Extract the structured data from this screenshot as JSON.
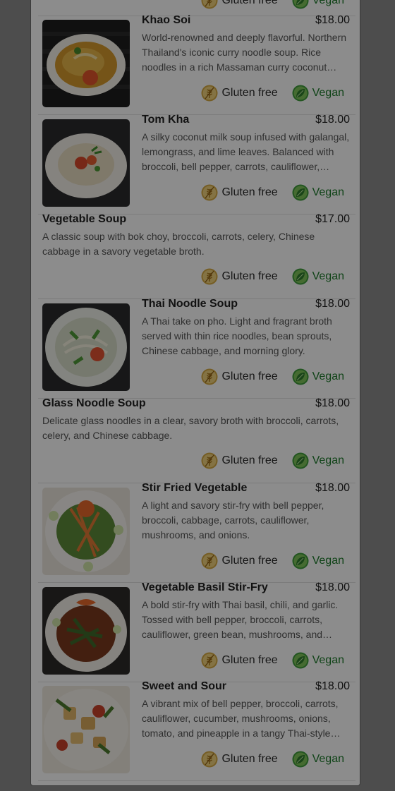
{
  "menu": {
    "tag_labels": {
      "gluten_free": "Gluten free",
      "vegan": "Vegan"
    },
    "colors": {
      "gluten_free": "#d6a943",
      "vegan": "#3f9b3b",
      "vegan_text": "#1d7a2a",
      "backdrop": "#8c8c8c"
    },
    "items": [
      {
        "name": "Khao Soi",
        "price": "$18.00",
        "description": "World-renowned and deeply flavorful. Northern Thailand's iconic curry noodle soup. Rice noodles in a rich Massaman curry coconut broth…",
        "has_image": true,
        "image_icon": "curry-noodle-soup-photo"
      },
      {
        "name": "Tom Kha",
        "price": "$18.00",
        "description": "A silky coconut milk soup infused with galangal, lemongrass, and lime leaves. Balanced with broccoli, bell pepper, carrots, cauliflower, mushrooms…",
        "has_image": true,
        "image_icon": "coconut-soup-photo"
      },
      {
        "name": "Vegetable Soup",
        "price": "$17.00",
        "description": "A classic soup with bok choy, broccoli, carrots, celery, Chinese cabbage in a savory vegetable broth.",
        "has_image": false
      },
      {
        "name": "Thai Noodle Soup",
        "price": "$18.00",
        "description": "A Thai take on pho. Light and fragrant broth served with thin rice noodles, bean sprouts, Chinese cabbage, and morning glory.",
        "has_image": true,
        "image_icon": "noodle-soup-photo"
      },
      {
        "name": "Glass Noodle Soup",
        "price": "$18.00",
        "description": "Delicate glass noodles in a clear, savory broth with broccoli, carrots, celery, and Chinese cabbage.",
        "has_image": false
      },
      {
        "name": "Stir Fried Vegetable",
        "price": "$18.00",
        "description": "A light and savory stir-fry with bell pepper, broccoli, cabbage, carrots, cauliflower, mushrooms, and onions.",
        "has_image": true,
        "image_icon": "stir-fry-photo"
      },
      {
        "name": "Vegetable Basil Stir-Fry",
        "price": "$18.00",
        "description": "A bold stir-fry with Thai basil, chili, and garlic. Tossed with bell pepper, broccoli, carrots, cauliflower, green bean, mushrooms, and onions…",
        "has_image": true,
        "image_icon": "basil-stir-fry-photo"
      },
      {
        "name": "Sweet and Sour",
        "price": "$18.00",
        "description": "A vibrant mix of bell pepper, broccoli, carrots, cauliflower, cucumber, mushrooms, onions, tomato, and pineapple in a tangy Thai-style sauce…",
        "has_image": true,
        "image_icon": "sweet-sour-photo"
      }
    ]
  }
}
